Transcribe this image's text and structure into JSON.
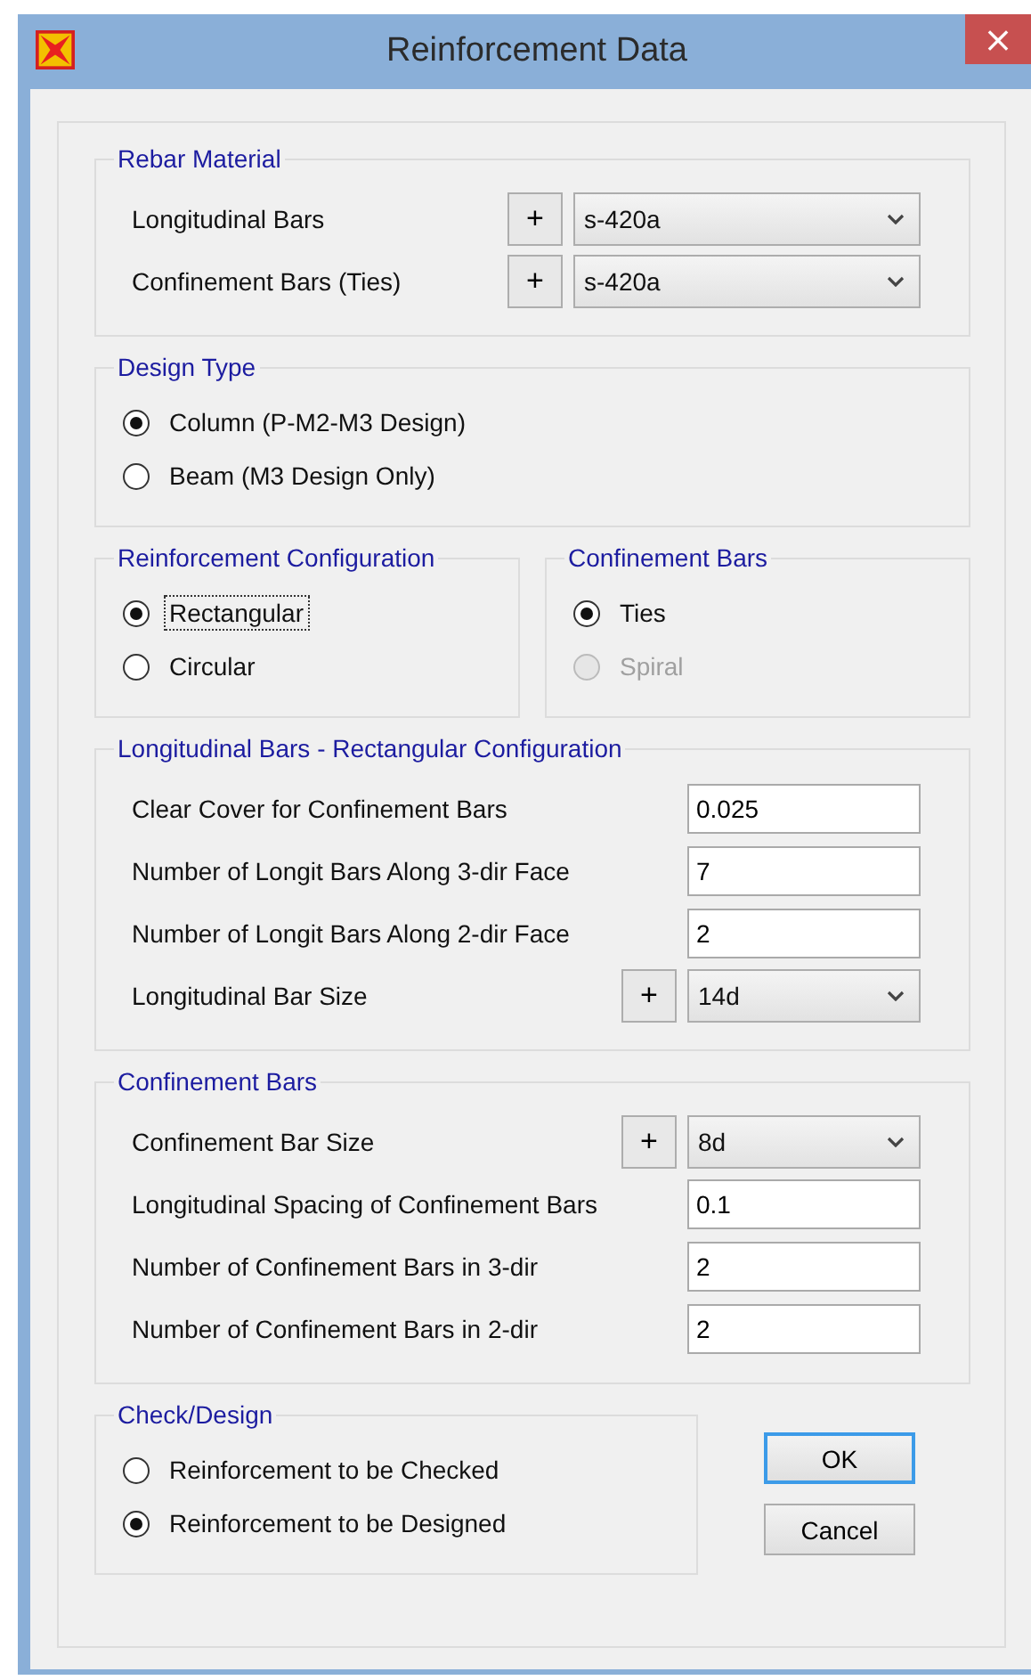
{
  "window": {
    "title": "Reinforcement Data",
    "close": "×"
  },
  "sections": [
    {
      "groups": [
        {
          "title": "Rebar Material",
          "rows": [
            {
              "kind": "combo",
              "label": "Longitudinal Bars",
              "plus": "+",
              "value": "s-420a"
            },
            {
              "kind": "combo",
              "label": "Confinement Bars  (Ties)",
              "plus": "+",
              "value": "s-420a"
            }
          ]
        }
      ]
    },
    {
      "groups": [
        {
          "title": "Design Type",
          "rows": [
            {
              "kind": "radio",
              "label": "Column  (P-M2-M3 Design)",
              "selected": true,
              "disabled": false,
              "focused": false
            },
            {
              "kind": "radio",
              "label": "Beam  (M3 Design Only)",
              "selected": false,
              "disabled": false,
              "focused": false
            }
          ]
        }
      ]
    },
    {
      "groups": [
        {
          "title": "Reinforcement Configuration",
          "rows": [
            {
              "kind": "radio",
              "label": "Rectangular",
              "selected": true,
              "disabled": false,
              "focused": true
            },
            {
              "kind": "radio",
              "label": "Circular",
              "selected": false,
              "disabled": false,
              "focused": false
            }
          ]
        },
        {
          "title": "Confinement Bars",
          "rows": [
            {
              "kind": "radio",
              "label": "Ties",
              "selected": true,
              "disabled": false,
              "focused": false
            },
            {
              "kind": "radio",
              "label": "Spiral",
              "selected": false,
              "disabled": true,
              "focused": false
            }
          ]
        }
      ]
    },
    {
      "groups": [
        {
          "title": "Longitudinal Bars - Rectangular Configuration",
          "rows": [
            {
              "kind": "text",
              "label": "Clear Cover for Confinement Bars",
              "value": "0.025"
            },
            {
              "kind": "text",
              "label": "Number of Longit Bars Along 3-dir Face",
              "value": "7"
            },
            {
              "kind": "text",
              "label": "Number of Longit Bars Along 2-dir Face",
              "value": "2"
            },
            {
              "kind": "combo",
              "label": "Longitudinal Bar Size",
              "plus": "+",
              "value": "14d"
            }
          ]
        }
      ]
    },
    {
      "groups": [
        {
          "title": "Confinement Bars",
          "rows": [
            {
              "kind": "combo",
              "label": "Confinement Bar Size",
              "plus": "+",
              "value": "8d"
            },
            {
              "kind": "text",
              "label": "Longitudinal Spacing of Confinement Bars",
              "value": "0.1"
            },
            {
              "kind": "text",
              "label": "Number of Confinement Bars in 3-dir",
              "value": "2"
            },
            {
              "kind": "text",
              "label": "Number of Confinement Bars in 2-dir",
              "value": "2"
            }
          ]
        }
      ]
    },
    {
      "groups": [
        {
          "title": "Check/Design",
          "rows": [
            {
              "kind": "radio",
              "label": "Reinforcement to be Checked",
              "selected": false,
              "disabled": false,
              "focused": false
            },
            {
              "kind": "radio",
              "label": "Reinforcement to be Designed",
              "selected": true,
              "disabled": false,
              "focused": false
            }
          ]
        }
      ],
      "buttons": [
        {
          "label": "OK",
          "default": true
        },
        {
          "label": "Cancel",
          "default": false
        }
      ]
    }
  ]
}
